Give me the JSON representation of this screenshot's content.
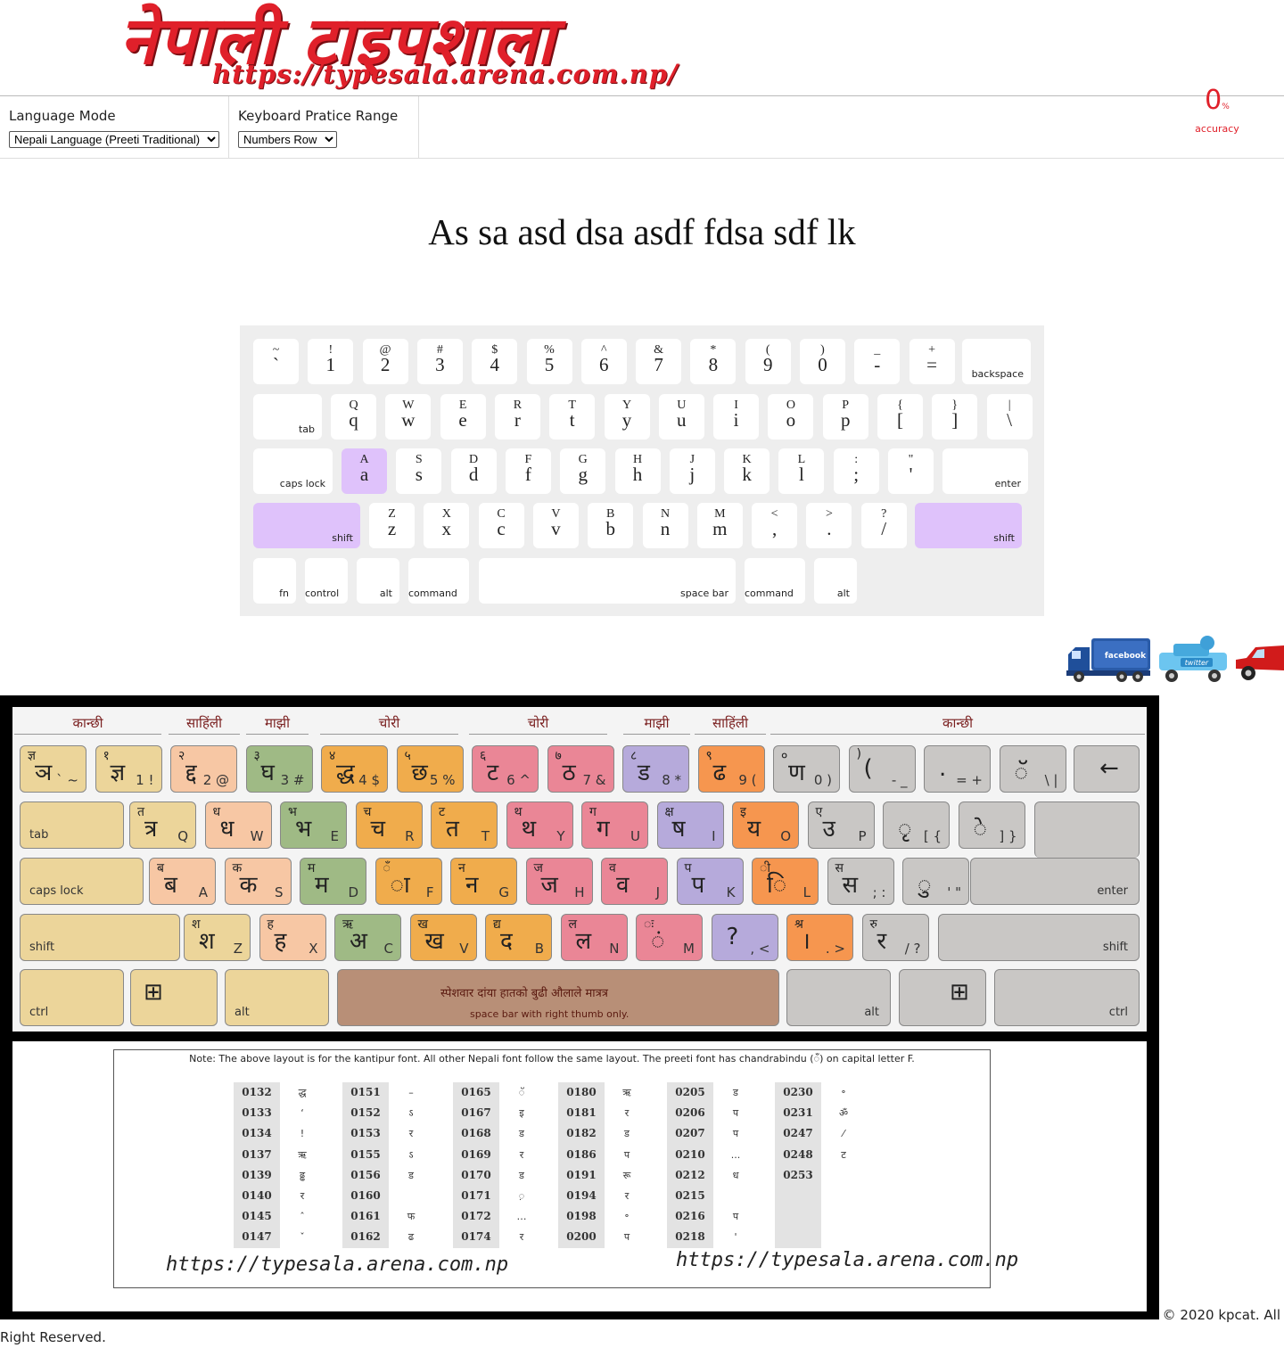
{
  "header": {
    "logo_title": "नेपाली टाइपशाला",
    "logo_url": "https://typesala.arena.com.np/"
  },
  "toolbar": {
    "language_label": "Language Mode",
    "language_selected": "Nepali Language (Preeti Traditional)",
    "range_label": "Keyboard Pratice Range",
    "range_selected": "Numbers Row"
  },
  "accuracy": {
    "value": "0",
    "unit": "%",
    "label": "accuracy"
  },
  "practice_text": "As sa asd dsa asdf fdsa sdf lk",
  "virtual_keyboard": {
    "highlight_color": "#dfc2fb",
    "highlighted_keys": [
      "a",
      "shift-left",
      "shift-right"
    ],
    "row1": [
      {
        "shift": "~",
        "main": "`"
      },
      {
        "shift": "!",
        "main": "1"
      },
      {
        "shift": "@",
        "main": "2"
      },
      {
        "shift": "#",
        "main": "3"
      },
      {
        "shift": "$",
        "main": "4"
      },
      {
        "shift": "%",
        "main": "5"
      },
      {
        "shift": "^",
        "main": "6"
      },
      {
        "shift": "&",
        "main": "7"
      },
      {
        "shift": "*",
        "main": "8"
      },
      {
        "shift": "(",
        "main": "9"
      },
      {
        "shift": ")",
        "main": "0"
      },
      {
        "shift": "_",
        "main": "-"
      },
      {
        "shift": "+",
        "main": "="
      }
    ],
    "row2": [
      {
        "shift": "Q",
        "main": "q"
      },
      {
        "shift": "W",
        "main": "w"
      },
      {
        "shift": "E",
        "main": "e"
      },
      {
        "shift": "R",
        "main": "r"
      },
      {
        "shift": "T",
        "main": "t"
      },
      {
        "shift": "Y",
        "main": "y"
      },
      {
        "shift": "U",
        "main": "u"
      },
      {
        "shift": "I",
        "main": "i"
      },
      {
        "shift": "O",
        "main": "o"
      },
      {
        "shift": "P",
        "main": "p"
      },
      {
        "shift": "{",
        "main": "["
      },
      {
        "shift": "}",
        "main": "]"
      },
      {
        "shift": "|",
        "main": "\\"
      }
    ],
    "row3": [
      {
        "shift": "A",
        "main": "a"
      },
      {
        "shift": "S",
        "main": "s"
      },
      {
        "shift": "D",
        "main": "d"
      },
      {
        "shift": "F",
        "main": "f"
      },
      {
        "shift": "G",
        "main": "g"
      },
      {
        "shift": "H",
        "main": "h"
      },
      {
        "shift": "J",
        "main": "j"
      },
      {
        "shift": "K",
        "main": "k"
      },
      {
        "shift": "L",
        "main": "l"
      },
      {
        "shift": ":",
        "main": ";"
      },
      {
        "shift": "\"",
        "main": "'"
      }
    ],
    "row4": [
      {
        "shift": "Z",
        "main": "z"
      },
      {
        "shift": "X",
        "main": "x"
      },
      {
        "shift": "C",
        "main": "c"
      },
      {
        "shift": "V",
        "main": "v"
      },
      {
        "shift": "B",
        "main": "b"
      },
      {
        "shift": "N",
        "main": "n"
      },
      {
        "shift": "M",
        "main": "m"
      },
      {
        "shift": "<",
        "main": ","
      },
      {
        "shift": ">",
        "main": "."
      },
      {
        "shift": "?",
        "main": "/"
      }
    ],
    "labels": {
      "backspace": "backspace",
      "tab": "tab",
      "caps": "caps lock",
      "enter": "enter",
      "shift": "shift",
      "fn": "fn",
      "control": "control",
      "alt": "alt",
      "command": "command",
      "space": "space bar"
    }
  },
  "social": [
    {
      "icon": "facebook-truck-icon",
      "text": "facebook"
    },
    {
      "icon": "twitter-truck-icon",
      "text": "twitter"
    },
    {
      "icon": "car-icon",
      "text": ""
    }
  ],
  "reference_keyboard": {
    "zones": [
      "कान्छी",
      "साहिंली",
      "माझी",
      "चोरी",
      "चोरी",
      "माझी",
      "साहिंली",
      "कान्छी"
    ],
    "row1": [
      {
        "dev": "ञ",
        "num": "ज्ञ",
        "lat": "` ~",
        "color": "c-tan"
      },
      {
        "dev": "ज्ञ",
        "num": "१",
        "lat": "1 !",
        "color": "c-tan"
      },
      {
        "dev": "द्द",
        "num": "२",
        "lat": "2 @",
        "color": "c-peach"
      },
      {
        "dev": "घ",
        "num": "३",
        "lat": "3 #",
        "color": "c-green"
      },
      {
        "dev": "द्ध",
        "num": "४",
        "lat": "4 $",
        "color": "c-orange"
      },
      {
        "dev": "छ",
        "num": "५",
        "lat": "5 %",
        "color": "c-orange"
      },
      {
        "dev": "ट",
        "num": "६",
        "lat": "6 ^",
        "color": "c-pink"
      },
      {
        "dev": "ठ",
        "num": "७",
        "lat": "7 &",
        "color": "c-pink"
      },
      {
        "dev": "ड",
        "num": "८",
        "lat": "8 *",
        "color": "c-purple"
      },
      {
        "dev": "ढ",
        "num": "९",
        "lat": "9 (",
        "color": "c-oran2"
      },
      {
        "dev": "ण",
        "num": "०",
        "lat": "0 )",
        "color": "c-grey"
      },
      {
        "dev": "(",
        "num": ")",
        "lat": "- _",
        "color": "c-grey"
      },
      {
        "dev": ".",
        "num": "",
        "lat": "= +",
        "color": "c-grey"
      },
      {
        "dev": "ॅ",
        "num": "",
        "lat": "\\ |",
        "color": "c-grey"
      }
    ],
    "row2": [
      {
        "dev": "त्र",
        "num": "त",
        "lat": "Q",
        "color": "c-tan"
      },
      {
        "dev": "ध",
        "num": "ध",
        "lat": "W",
        "color": "c-peach"
      },
      {
        "dev": "भ",
        "num": "भ",
        "lat": "E",
        "color": "c-green"
      },
      {
        "dev": "च",
        "num": "च",
        "lat": "R",
        "color": "c-orange"
      },
      {
        "dev": "त",
        "num": "ट",
        "lat": "T",
        "color": "c-orange"
      },
      {
        "dev": "थ",
        "num": "थ",
        "lat": "Y",
        "color": "c-pink"
      },
      {
        "dev": "ग",
        "num": "ग",
        "lat": "U",
        "color": "c-pink"
      },
      {
        "dev": "ष",
        "num": "क्ष",
        "lat": "I",
        "color": "c-purple"
      },
      {
        "dev": "य",
        "num": "इ",
        "lat": "O",
        "color": "c-oran2"
      },
      {
        "dev": "उ",
        "num": "ए",
        "lat": "P",
        "color": "c-grey"
      },
      {
        "dev": "ृ",
        "num": "",
        "lat": "[ {",
        "color": "c-grey"
      },
      {
        "dev": "े",
        "num": "",
        "lat": "] }",
        "color": "c-grey"
      }
    ],
    "row3": [
      {
        "dev": "ब",
        "num": "ब",
        "lat": "A",
        "color": "c-peach"
      },
      {
        "dev": "क",
        "num": "क",
        "lat": "S",
        "color": "c-peach"
      },
      {
        "dev": "म",
        "num": "म",
        "lat": "D",
        "color": "c-green"
      },
      {
        "dev": "ा",
        "num": "ँ",
        "lat": "F",
        "color": "c-orange"
      },
      {
        "dev": "न",
        "num": "न",
        "lat": "G",
        "color": "c-orange"
      },
      {
        "dev": "ज",
        "num": "ज",
        "lat": "H",
        "color": "c-pink"
      },
      {
        "dev": "व",
        "num": "व",
        "lat": "J",
        "color": "c-pink"
      },
      {
        "dev": "प",
        "num": "प",
        "lat": "K",
        "color": "c-purple"
      },
      {
        "dev": "ि",
        "num": "ी",
        "lat": "L",
        "color": "c-oran2"
      },
      {
        "dev": "स",
        "num": "स",
        "lat": "; :",
        "color": "c-grey"
      },
      {
        "dev": "ु",
        "num": "",
        "lat": "' \"",
        "color": "c-grey"
      }
    ],
    "row4": [
      {
        "dev": "श",
        "num": "श",
        "lat": "Z",
        "color": "c-tan"
      },
      {
        "dev": "ह",
        "num": "ह",
        "lat": "X",
        "color": "c-peach"
      },
      {
        "dev": "अ",
        "num": "ऋ",
        "lat": "C",
        "color": "c-green"
      },
      {
        "dev": "ख",
        "num": "ख",
        "lat": "V",
        "color": "c-orange"
      },
      {
        "dev": "द",
        "num": "द्य",
        "lat": "B",
        "color": "c-orange"
      },
      {
        "dev": "ल",
        "num": "ल",
        "lat": "N",
        "color": "c-pink"
      },
      {
        "dev": "ं",
        "num": "ः",
        "lat": "M",
        "color": "c-pink"
      },
      {
        "dev": "?",
        "num": "",
        "lat": ", <",
        "color": "c-purple"
      },
      {
        "dev": "।",
        "num": "श्र",
        "lat": ". >",
        "color": "c-oran2"
      },
      {
        "dev": "र",
        "num": "रु",
        "lat": "/ ?",
        "color": "c-grey"
      }
    ],
    "labels": {
      "tab": "tab",
      "caps": "caps lock",
      "enter": "enter",
      "shift": "shift",
      "ctrl": "ctrl",
      "alt": "alt",
      "space_np": "स्पेशवार दांया हातको बुढी औलाले मात्रत्र",
      "space_en": "space bar with right thumb only."
    }
  },
  "note": {
    "text": "Note: The above layout is for the kantipur font. All other Nepali font follow the same layout. The preeti font has chandrabindu (ँ) on capital letter F.",
    "codes": [
      [
        "0132",
        "0133",
        "0134",
        "0137",
        "0139",
        "0140",
        "0145",
        "0147"
      ],
      [
        "0151",
        "0152",
        "0153",
        "0155",
        "0156",
        "0160",
        "0161",
        "0162"
      ],
      [
        "0165",
        "0167",
        "0168",
        "0169",
        "0170",
        "0171",
        "0172",
        "0174"
      ],
      [
        "0180",
        "0181",
        "0182",
        "0186",
        "0191",
        "0194",
        "0198",
        "0200"
      ],
      [
        "0205",
        "0206",
        "0207",
        "0210",
        "0212",
        "0215",
        "0216",
        "0218"
      ],
      [
        "0230",
        "0231",
        "0247",
        "0248",
        "0253"
      ]
    ],
    "glyphs": [
      [
        "द्ध",
        "‘",
        "!",
        "ऋ",
        "ढ्ढ",
        "र",
        "ˆ",
        "ˇ"
      ],
      [
        "–",
        "ऽ",
        "र",
        "ऽ",
        "ड",
        "",
        "फ",
        "ढ"
      ],
      [
        "ॅ",
        "इ",
        "ड",
        "र",
        "ड",
        "़",
        "…",
        "र"
      ],
      [
        "ऋ",
        "र",
        "ड",
        "प",
        "रू",
        "र",
        "॰",
        "प"
      ],
      [
        "ड",
        "प",
        "प",
        "...",
        "ध",
        "",
        "प",
        "'"
      ],
      [
        "॰",
        "ॐ",
        "⁄",
        "ट"
      ]
    ],
    "url_left": "https://typesala.arena.com.np",
    "url_right": "https://typesala.arena.com.np"
  },
  "footer": {
    "line1": "© 2020 kpcat. All",
    "line2": "Right Reserved."
  }
}
